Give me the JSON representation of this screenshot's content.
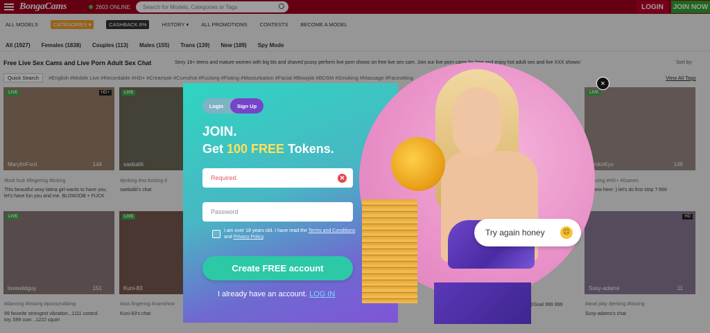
{
  "header": {
    "logo": "BongaCams",
    "online_count": "2603 ONLINE",
    "search_placeholder": "Search for Models, Categories or Tags",
    "login_label": "LOGIN",
    "join_label": "JOIN NOW"
  },
  "nav": {
    "items": [
      "ALL MODELS",
      "CATEGORIES ▾",
      "CASHBACK 6%",
      "HISTORY ▾",
      "ALL PROMOTIONS",
      "CONTESTS",
      "BECOME A MODEL"
    ]
  },
  "filters": {
    "items": [
      "All (1927)",
      "Females (1838)",
      "Couples (113)",
      "Males (155)",
      "Trans (139)",
      "New (189)",
      "Spy Mode"
    ]
  },
  "page": {
    "headline": "Free Live Sex Cams and Live Porn Adult Sex Chat",
    "description": "Sexy 18+ teens and mature women with big tits and shaved pussy perform live porn shows on free live sex cam. Join our live porn cams for free and enjoy hot adult sex and live XXX shows!",
    "sort_label": "Sort by:",
    "quick_search": "Quick Search",
    "tags": "#English  #Mobile Live  #Recordable  #HD+  #Creampie  #Cumshot  #Fucking  #Fisting  #Masturbation  #Facial  #Blowjob  #BDSM  #Smoking  #Massage  #Facesitting",
    "view_all_tags": "View All Tags"
  },
  "cards": [
    {
      "name": "MarylinFord",
      "count": "144",
      "badge": "LIVE",
      "tags": "#butt fuck  #fingering  #licking",
      "desc": "This beautiful sexy latina girl wants to have you, let's have fun you and me. BLOWJOB + FUCK"
    },
    {
      "name": "saebaliii",
      "count": "",
      "badge": "LIVE",
      "tags": "#jerking  #no fucking  #",
      "desc": "saebaliii's chat"
    },
    {
      "name": "lovewildguy",
      "count": "151",
      "badge": "LIVE",
      "tags": "#dancing  #kissing  #pussyrubbing",
      "desc": "99 favorite strongest vibration...1111 control toy..599 cum ..1222 squirt"
    },
    {
      "name": "Kuni-83",
      "count": "",
      "badge": "LIVE",
      "tags": "#ass fingering  #camshow",
      "desc": "Kuni-83's chat"
    },
    {
      "name": "KyokoKyo",
      "count": "149",
      "badge": "LIVE",
      "tags": "#dancing  #HD+  #Games",
      "desc": "I'm new here :) let's do first strip ? 666"
    },
    {
      "name": "Susy-adams",
      "count": "11",
      "badge": "HD",
      "tags": "#anal play  #jerking  #kissing",
      "desc": "Susy-adams's chat"
    }
  ],
  "card_extra_desc": "rrison88 @Goal 999 999",
  "modal": {
    "tab_login": "Login",
    "tab_signup": "Sign Up",
    "title": "JOIN.",
    "subtitle_pre": "Get ",
    "subtitle_highlight": "100 FREE",
    "subtitle_post": " Tokens.",
    "email_placeholder": "Required.",
    "password_placeholder": "Password",
    "terms_pre": "I am over 18 years old. I have read the ",
    "terms_link1": "Terms and Conditions",
    "terms_mid": " and ",
    "terms_link2": "Privacy Policy",
    "terms_post": ".",
    "create_label": "Create FREE account",
    "have_account": "I already have an account.",
    "login_link": "LOG IN",
    "bubble_text": "Try again honey",
    "close_symbol": "×"
  },
  "colors": {
    "brand": "#a4001e",
    "join": "#2fa62f",
    "modal_accent": "#7544c9",
    "create_button": "#2dc8a6",
    "highlight": "#ffe15a"
  }
}
